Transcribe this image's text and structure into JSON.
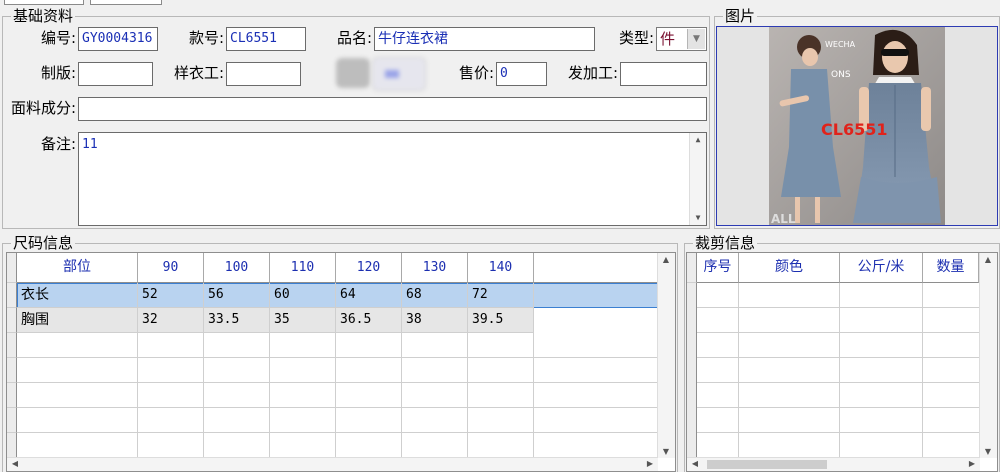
{
  "basic": {
    "title": "基础资料",
    "fields": {
      "code_label": "编号:",
      "code_value": "GY0004316",
      "style_label": "款号:",
      "style_value": "CL6551",
      "name_label": "品名:",
      "name_value": "牛仔连衣裙",
      "type_label": "类型:",
      "type_value": "件",
      "plate_label": "制版:",
      "plate_value": "",
      "sample_label": "样衣工:",
      "sample_value": "",
      "price_label": "售价:",
      "price_value": "0",
      "process_label": "发加工:",
      "process_value": "",
      "fabric_label": "面料成分:",
      "fabric_value": "",
      "remark_label": "备注:",
      "remark_value": "11"
    }
  },
  "picture": {
    "title": "图片",
    "overlay_text": "CL6551",
    "brand_text_1": "WECHA",
    "brand_text_2": "ONS",
    "bottom_text": "ALL"
  },
  "size": {
    "title": "尺码信息",
    "columns": [
      "部位",
      "90",
      "100",
      "110",
      "120",
      "130",
      "140"
    ],
    "rows": [
      [
        "衣长",
        "52",
        "56",
        "60",
        "64",
        "68",
        "72"
      ],
      [
        "胸围",
        "32",
        "33.5",
        "35",
        "36.5",
        "38",
        "39.5"
      ]
    ]
  },
  "cut": {
    "title": "裁剪信息",
    "columns": [
      "序号",
      "颜色",
      "公斤/米",
      "数量"
    ]
  },
  "colors": {
    "accent_text": "#1a2fb5",
    "selected_row": "#b9d3f0",
    "type_value_color": "#7a1030",
    "overlay_red": "#e0231b"
  }
}
